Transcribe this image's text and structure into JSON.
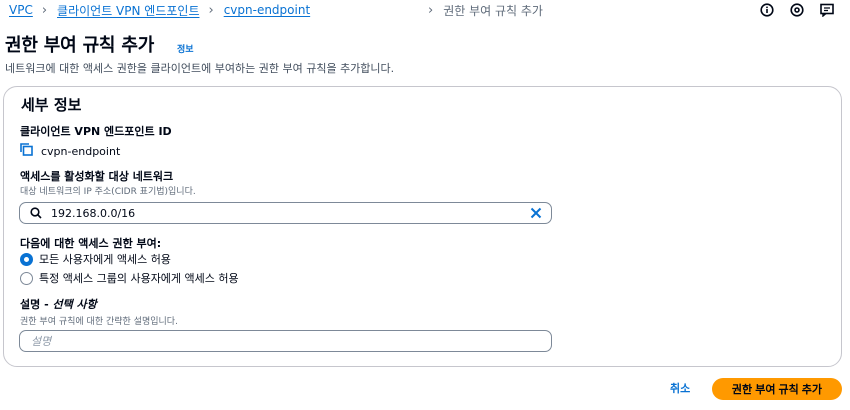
{
  "breadcrumb": {
    "items": [
      "VPC",
      "클라이언트 VPN 엔드포인트",
      "cvpn-endpoint"
    ],
    "current": "권한 부여 규칙 추가"
  },
  "top_icons": [
    "info-circle-icon",
    "settings-icon",
    "feedback-icon"
  ],
  "header": {
    "title": "권한 부여 규칙 추가",
    "info_label": "정보",
    "description": "네트워크에 대한 액세스 권한을 클라이언트에 부여하는 권한 부여 규칙을 추가합니다."
  },
  "panel": {
    "title": "세부 정보",
    "endpoint_label": "클라이언트 VPN 엔드포인트 ID",
    "endpoint_value": "cvpn-endpoint",
    "network_label": "액세스를 활성화할 대상 네트워크",
    "network_hint": "대상 네트워크의 IP 주소(CIDR 표기법)입니다.",
    "network_value": "192.168.0.0/16",
    "grant_label": "다음에 대한 액세스 권한 부여:",
    "grant_options": [
      {
        "label": "모든 사용자에게 액세스 허용",
        "selected": true
      },
      {
        "label": "특정 액세스 그룹의 사용자에게 액세스 허용",
        "selected": false
      }
    ],
    "desc_label_main": "설명 - ",
    "desc_label_optional": "선택 사항",
    "desc_hint": "권한 부여 규칙에 대한 간략한 설명입니다.",
    "desc_placeholder": "설명"
  },
  "footer": {
    "cancel_label": "취소",
    "submit_label": "권한 부여 규칙 추가"
  },
  "colors": {
    "link": "#0972d3",
    "primary": "#ff9900",
    "border": "#c6c6cd"
  }
}
